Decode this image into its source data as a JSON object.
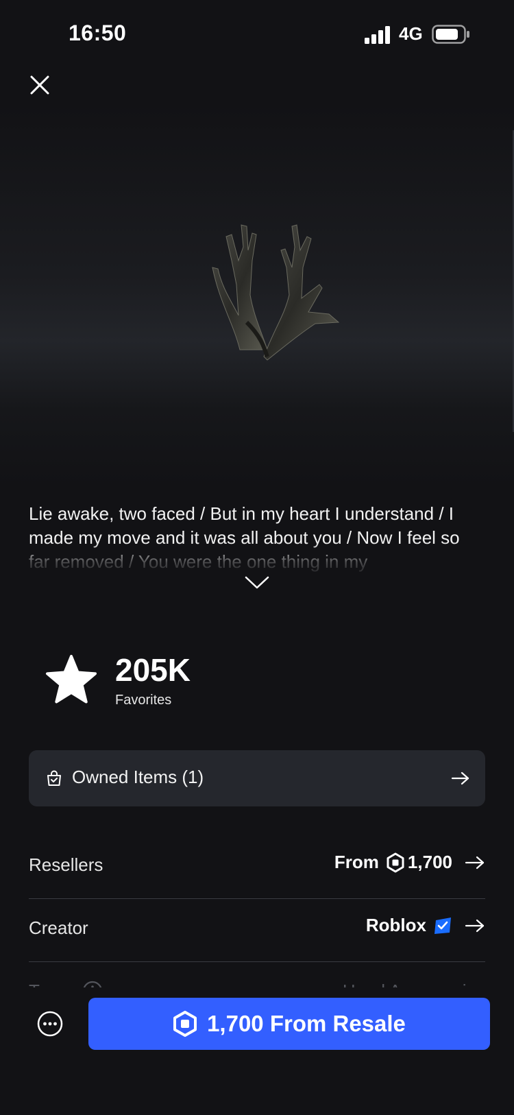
{
  "status_bar": {
    "time": "16:50",
    "network": "4G"
  },
  "item": {
    "description": "Lie awake, two faced / But in my heart I understand / I made my move and it was all about you / Now I feel so far removed / You were the one thing in my",
    "favorites_count": "205K",
    "favorites_label": "Favorites"
  },
  "owned": {
    "label": "Owned Items (1)"
  },
  "details": {
    "resellers_label": "Resellers",
    "resellers_prefix": "From",
    "resellers_price": "1,700",
    "creator_label": "Creator",
    "creator_name": "Roblox",
    "type_label": "Type",
    "type_value": "Head Accessories"
  },
  "buy_button": {
    "label": "1,700 From Resale"
  },
  "colors": {
    "accent": "#335fff",
    "background": "#121215",
    "card": "#25272d",
    "verified": "#1a6dff"
  }
}
